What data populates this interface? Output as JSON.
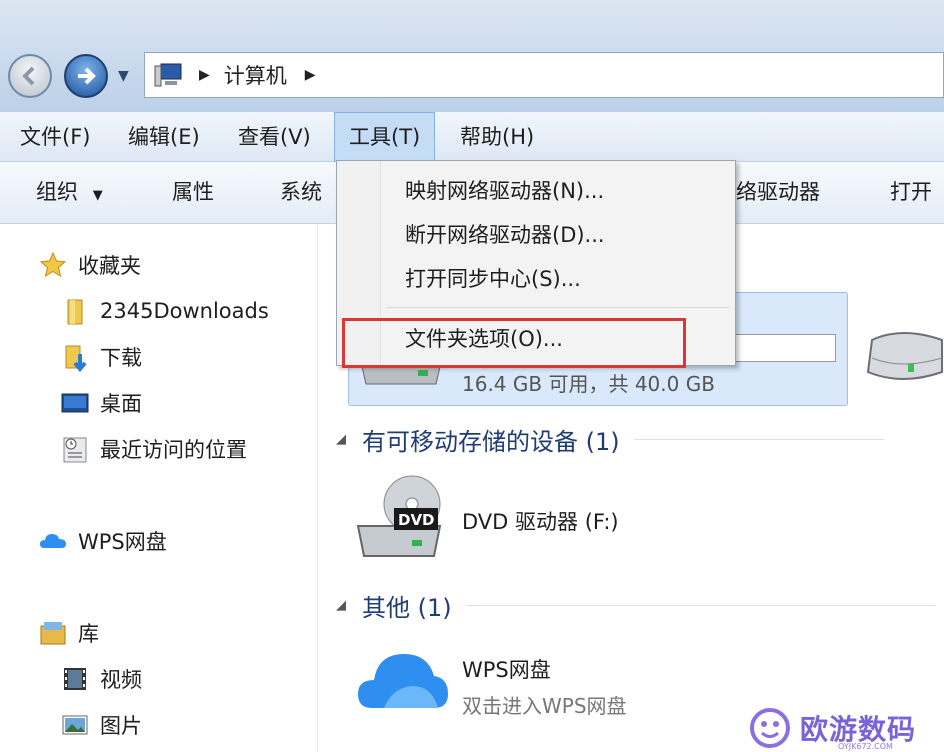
{
  "address": {
    "crumbs": [
      "计算机"
    ]
  },
  "menubar": {
    "items": [
      {
        "label": "文件(F)"
      },
      {
        "label": "编辑(E)"
      },
      {
        "label": "查看(V)"
      },
      {
        "label": "工具(T)"
      },
      {
        "label": "帮助(H)"
      }
    ],
    "active_index": 3
  },
  "toolbar": {
    "organize": "组织",
    "properties": "属性",
    "system_partial": "系统",
    "network_drive_partial": "络驱动器",
    "open_partial": "打开"
  },
  "tools_menu": {
    "items": [
      {
        "label": "映射网络驱动器(N)..."
      },
      {
        "label": "断开网络驱动器(D)..."
      },
      {
        "label": "打开同步中心(S)..."
      },
      {
        "label": "文件夹选项(O)..."
      }
    ],
    "highlighted_index": 3
  },
  "sidebar": {
    "favorites": {
      "label": "收藏夹"
    },
    "items": [
      {
        "label": "2345Downloads",
        "icon": "folder-icon"
      },
      {
        "label": "下载",
        "icon": "download-folder-icon"
      },
      {
        "label": "桌面",
        "icon": "desktop-icon"
      },
      {
        "label": "最近访问的位置",
        "icon": "recent-places-icon"
      }
    ],
    "wps": {
      "label": "WPS网盘"
    },
    "library": {
      "label": "库"
    },
    "library_items": [
      {
        "label": "视频",
        "icon": "video-icon"
      },
      {
        "label": "图片",
        "icon": "pictures-icon"
      }
    ]
  },
  "content": {
    "drive": {
      "capacity_text": "16.4 GB 可用，共 40.0 GB",
      "used_fraction": 0.59
    },
    "group_removable": "有可移动存储的设备 (1)",
    "dvd": {
      "name": "DVD 驱动器 (F:)",
      "badge": "DVD"
    },
    "group_other": "其他 (1)",
    "wps": {
      "name": "WPS网盘",
      "sub": "双击进入WPS网盘"
    }
  },
  "watermark": {
    "text": "欧游数码",
    "sub": "OYJK672.COM"
  },
  "colors": {
    "accent": "#1f3c74",
    "highlight_border": "#d93636",
    "menu_active": "#c4dcf6"
  }
}
